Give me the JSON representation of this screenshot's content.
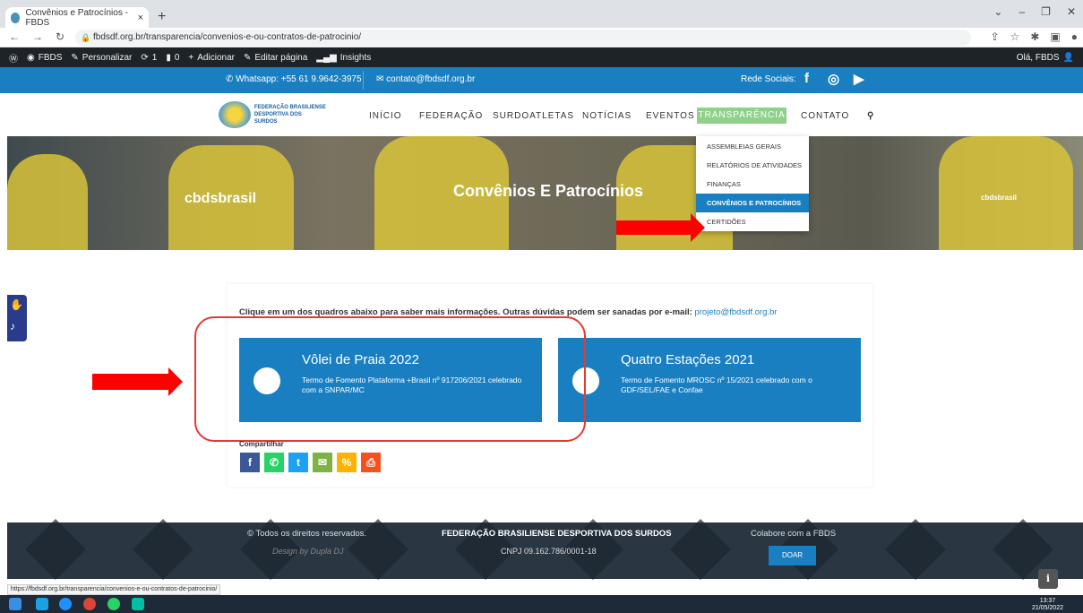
{
  "browser": {
    "tab_title": "Convênios e Patrocínios - FBDS",
    "tab_close": "×",
    "new_tab": "+",
    "url": "fbdsdf.org.br/transparencia/convenios-e-ou-contratos-de-patrocinio/",
    "status_url": "https://fbdsdf.org.br/transparencia/convenios-e-ou-contratos-de-patrocinio/"
  },
  "wp_admin_bar": {
    "site": "FBDS",
    "customize": "Personalizar",
    "updates": "1",
    "comments": "0",
    "new": "Adicionar",
    "edit": "Editar página",
    "insights": "Insights",
    "greeting": "Olá, FBDS"
  },
  "topbar": {
    "whatsapp": "Whatsapp: +55 61 9.9642-3975",
    "email": "contato@fbdsdf.org.br",
    "social_label": "Rede Sociais:"
  },
  "logo": {
    "line1": "FEDERAÇÃO BRASILIENSE",
    "line2": "DESPORTIVA DOS SURDOS"
  },
  "nav": {
    "items": [
      "INÍCIO",
      "FEDERAÇÃO",
      "SURDOATLETAS",
      "NOTÍCIAS",
      "EVENTOS"
    ],
    "active": "TRANSPARÊNCIA",
    "contact": "CONTATO"
  },
  "dropdown": {
    "items": [
      "ASSEMBLEIAS GERAIS",
      "RELATÓRIOS DE ATIVIDADES",
      "FINANÇAS",
      "CONVÊNIOS E PATROCÍNIOS",
      "CERTIDÕES"
    ]
  },
  "hero": {
    "title": "Convênios E Patrocínios",
    "brand_left": "cbdsbrasil",
    "brand_right": "cbdsbrasil"
  },
  "content": {
    "intro": "Clique em um dos quadros abaixo para saber mais informações. Outras dúvidas podem ser sanadas por e-mail:",
    "intro_email": "projeto@fbdsdf.org.br",
    "cards": [
      {
        "title": "Vôlei de Praia 2022",
        "description": "Termo de Fomento Plataforma +Brasil nº 917206/2021 celebrado com a SNPAR/MC"
      },
      {
        "title": "Quatro Estações 2021",
        "description": "Termo de Fomento MROSC nº 15/2021 celebrado com o GDF/SEL/FAE e Confae"
      }
    ],
    "share_label": "Compartilhar"
  },
  "footer": {
    "rights": "© Todos os direitos reservados.",
    "design": "Design by Dupla DJ",
    "org_name": "FEDERAÇÃO BRASILIENSE DESPORTIVA DOS SURDOS",
    "cnpj": "CNPJ 09.162.786/0001-18",
    "colab": "Colabore com a FBDS",
    "donate": "DOAR"
  },
  "taskbar": {
    "time": "13:37",
    "date": "21/05/2022"
  },
  "colors": {
    "primary": "#1a7fc1",
    "active_nav": "#8fd18a",
    "annotation": "#ff0000"
  }
}
